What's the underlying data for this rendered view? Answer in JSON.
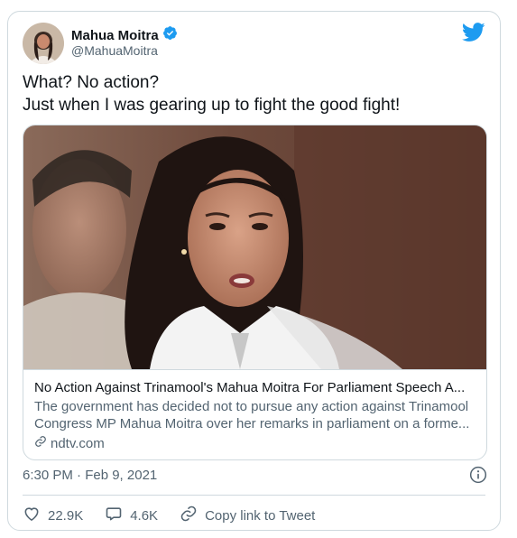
{
  "author": {
    "name": "Mahua Moitra",
    "handle": "@MahuaMoitra",
    "verified": true
  },
  "tweet": {
    "lines": [
      "What? No action?",
      "Just when I was gearing up to fight the good fight!"
    ]
  },
  "link_card": {
    "title": "No Action Against Trinamool's Mahua Moitra For Parliament Speech A...",
    "description_lines": [
      "The government has decided not to pursue any action against Trinamool",
      "Congress MP Mahua Moitra over her remarks in parliament on a forme..."
    ],
    "domain": "ndtv.com"
  },
  "timestamp": "6:30 PM · Feb 9, 2021",
  "actions": {
    "likes": "22.9K",
    "replies": "4.6K",
    "copy_link": "Copy link to Tweet"
  },
  "colors": {
    "twitter_blue": "#1d9bf0",
    "text_primary": "#0f1419",
    "text_secondary": "#536471",
    "border": "#cfd9de"
  },
  "icons": [
    "twitter-bird-icon",
    "verified-badge-icon",
    "link-icon",
    "info-icon",
    "heart-icon",
    "reply-icon"
  ]
}
